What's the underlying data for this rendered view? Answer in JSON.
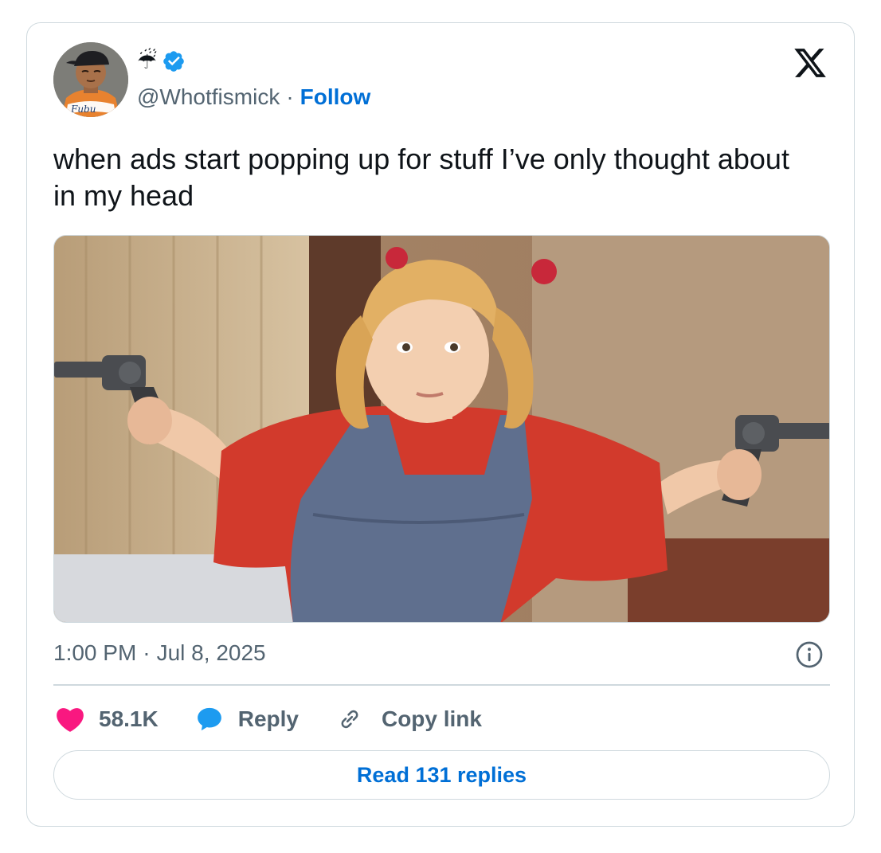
{
  "author": {
    "display_emoji": "☔",
    "handle": "@Whotfismick",
    "separator": "·",
    "follow_label": "Follow",
    "avatar_shirt_text": "Fubu",
    "verified": true
  },
  "tweet": {
    "text": "when ads start popping up for stuff I’ve only thought about in my head",
    "time": "1:00 PM",
    "separator": "·",
    "date": "Jul 8, 2025"
  },
  "actions": {
    "likes_count": "58.1K",
    "reply_label": "Reply",
    "copy_link_label": "Copy link",
    "read_replies_label": "Read 131 replies"
  },
  "icons": {
    "like": "heart-icon",
    "reply": "speech-bubble-icon",
    "copy": "link-icon",
    "info": "info-icon",
    "platform": "x-logo-icon",
    "verified": "verified-badge-icon"
  },
  "colors": {
    "like": "#f91880",
    "reply": "#1d9bf0",
    "link": "#006fd6",
    "muted": "#536471",
    "border": "#cfd9de",
    "text": "#0f1419"
  }
}
